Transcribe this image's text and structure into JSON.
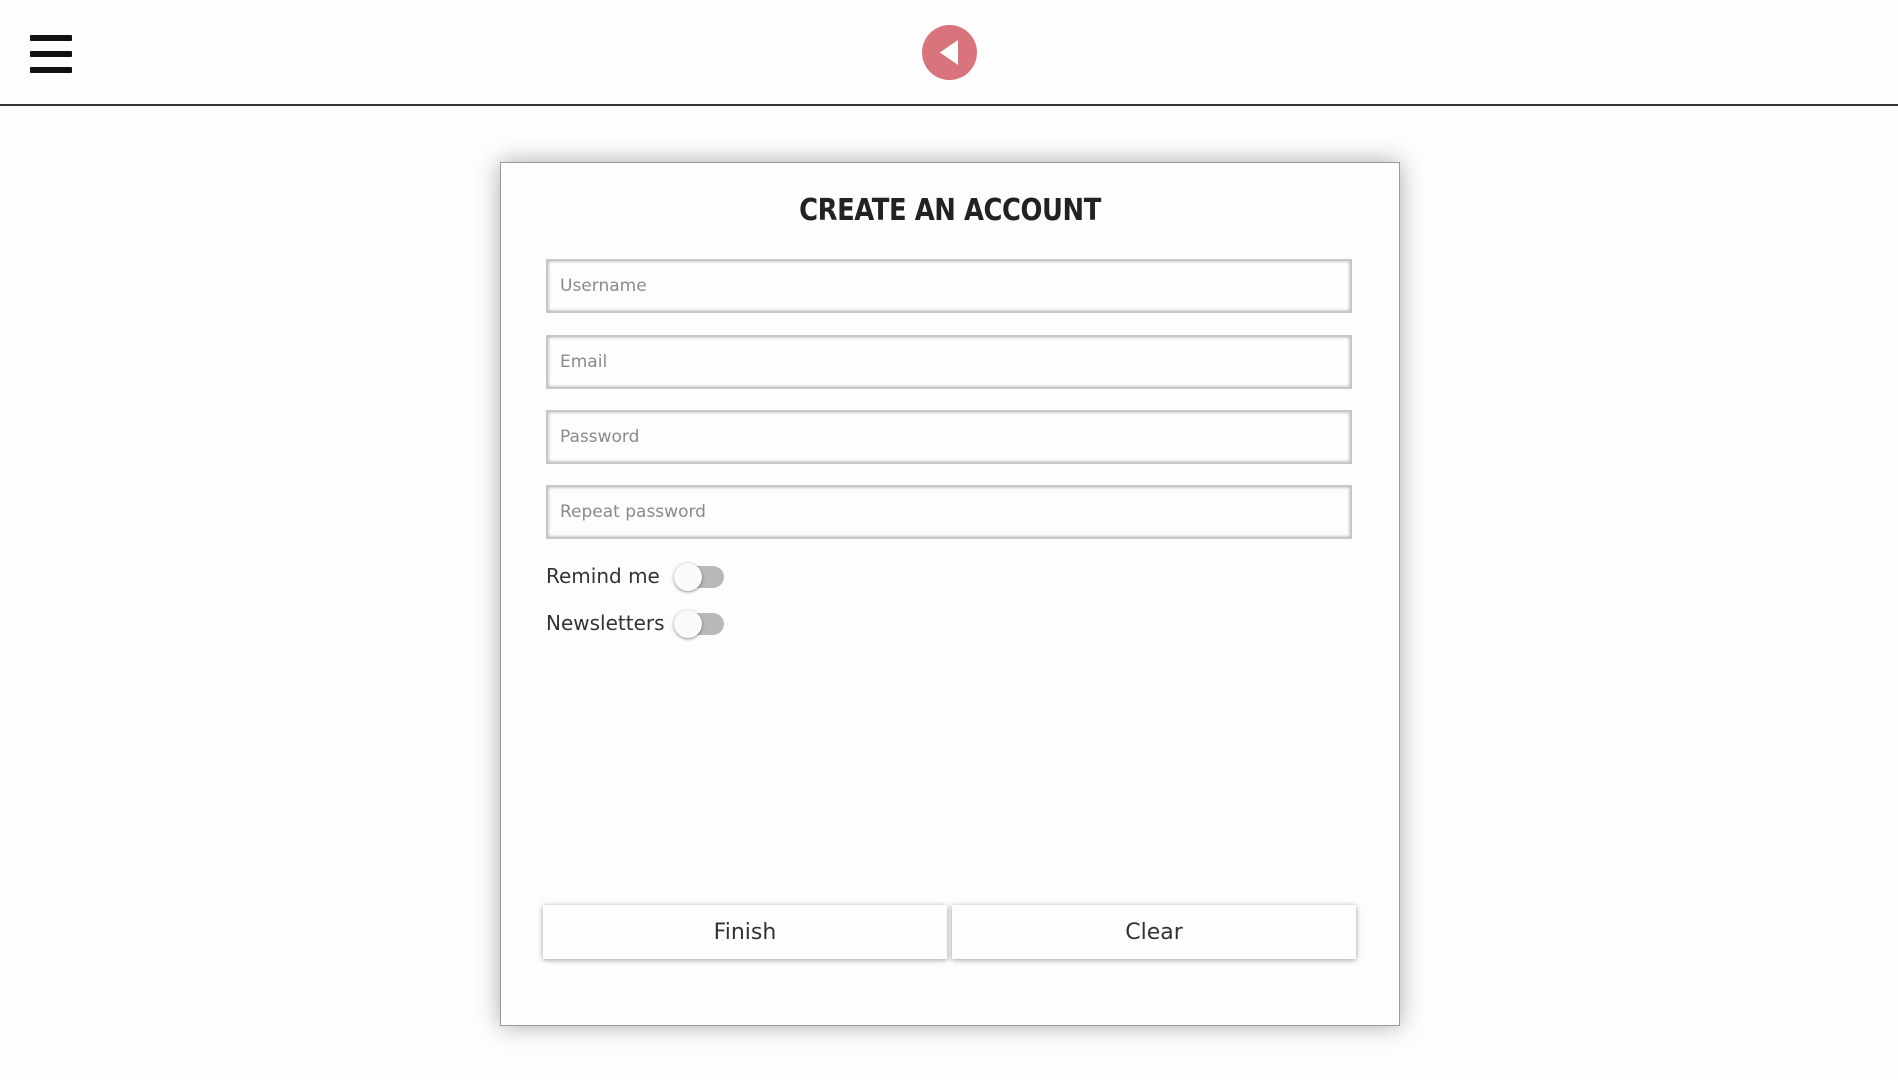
{
  "header": {
    "menu_icon": "hamburger-menu-icon",
    "back_icon": "back-arrow-icon",
    "back_color": "#d9747c"
  },
  "form": {
    "title": "CREATE AN ACCOUNT",
    "fields": {
      "username": {
        "placeholder": "Username",
        "value": ""
      },
      "email": {
        "placeholder": "Email",
        "value": ""
      },
      "password": {
        "placeholder": "Password",
        "value": ""
      },
      "repeat_password": {
        "placeholder": "Repeat password",
        "value": ""
      }
    },
    "toggles": {
      "remind_me": {
        "label": "Remind me",
        "on": false
      },
      "newsletters": {
        "label": "Newsletters",
        "on": false
      }
    },
    "buttons": {
      "finish": "Finish",
      "clear": "Clear"
    }
  }
}
